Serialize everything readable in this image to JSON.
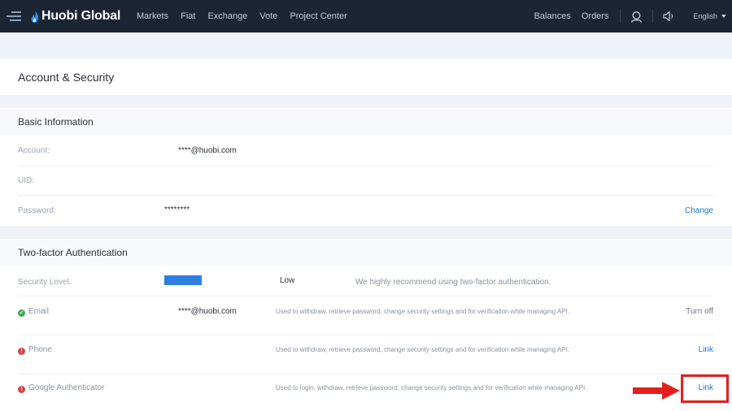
{
  "nav": {
    "logo": {
      "brand": "Huobi",
      "suffix": "Global"
    },
    "links": [
      "Markets",
      "Fiat",
      "Exchange",
      "Vote",
      "Project Center"
    ],
    "right_links": [
      "Balances",
      "Orders"
    ],
    "language": "English"
  },
  "page": {
    "title": "Account & Security"
  },
  "basic": {
    "title": "Basic Information",
    "account_label": "Account:",
    "account_value": "****@huobi.com",
    "uid_label": "UID:",
    "password_label": "Password:",
    "password_value": "********",
    "password_action": "Change"
  },
  "twofa": {
    "title": "Two-factor Authentication",
    "security_label": "Security Level:",
    "security_level": "Low",
    "security_note": "We highly recommend using two-factor authentication.",
    "items": [
      {
        "label": "Email",
        "value": "****@huobi.com",
        "desc": "Used to withdraw, retrieve password, change security settings and for verification while managing API.",
        "action": "Turn off",
        "status": "verified"
      },
      {
        "label": "Phone",
        "value": "",
        "desc": "Used to withdraw, retrieve password, change security settings and for verification while managing API.",
        "action": "Link",
        "status": "unlinked"
      },
      {
        "label": "Google Authenticator",
        "value": "",
        "desc": "Used to login, withdraw, retrieve password, change security settings and for verification while managing API.",
        "action": "Link",
        "status": "unlinked"
      }
    ]
  },
  "colors": {
    "nav_bg": "#1b2533",
    "link_blue": "#1f74d8",
    "verified_green": "#3ca95a",
    "warning_red": "#d14649",
    "highlight_red": "#e41e1e",
    "level_bar": "#2f7fe0"
  },
  "icons": {
    "menu": "menu-icon",
    "user": "user-icon",
    "speaker": "speaker-icon",
    "verified": "check-circle-icon",
    "warning": "exclamation-circle-icon",
    "arrow": "arrow-right-icon"
  }
}
